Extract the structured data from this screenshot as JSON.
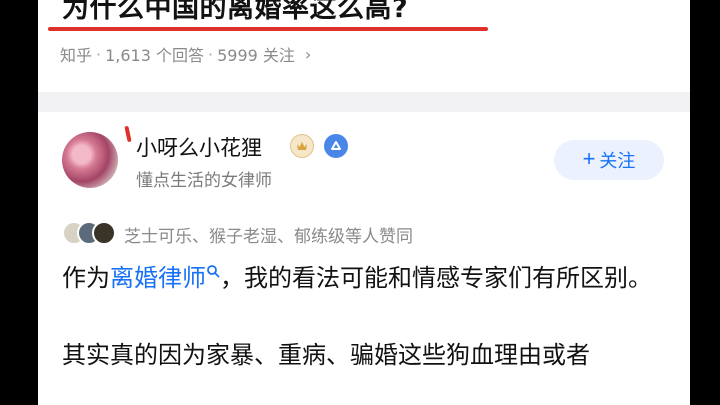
{
  "question": {
    "title": "为什么中国的离婚率这么高?",
    "source": "知乎",
    "answers": "1,613 个回答",
    "followers": "5999 关注",
    "separator": "·",
    "chevron": "›"
  },
  "answer": {
    "author_name": "小呀么小花狸",
    "author_desc": "懂点生活的女律师",
    "badges": [
      "gold-badge-icon",
      "verified-icon"
    ],
    "follow_label": "关注",
    "follow_plus": "+",
    "voters_text": "芝士可乐、猴子老湿、郁练级等人赞同",
    "content": {
      "p1_prefix": "作为",
      "p1_link": "离婚律师",
      "p1_suffix": "，我的看法可能和情感专家们有所区别。",
      "p2": "其实真的因为家暴、重病、骗婚这些狗血理由或者"
    }
  },
  "colors": {
    "accent": "#1772f6",
    "underline": "#e0302a",
    "follow_bg": "#ebf2fd",
    "divider": "#f2f2f4"
  }
}
